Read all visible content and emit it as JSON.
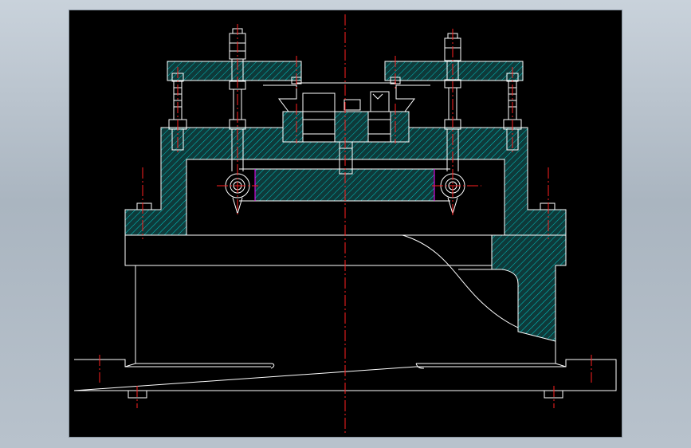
{
  "colors": {
    "window_bg": "#b4bec8",
    "canvas_bg": "#000000",
    "outline": "#ffffff",
    "hatch": "#00c8c8",
    "hatch_fill": "#0e3a3a",
    "centerline": "#ff2020",
    "highlight": "#ff00ff"
  },
  "drawing": {
    "view": "front-section",
    "hatch_pattern": "ANSI31",
    "centerline_style": "dash-dot"
  }
}
